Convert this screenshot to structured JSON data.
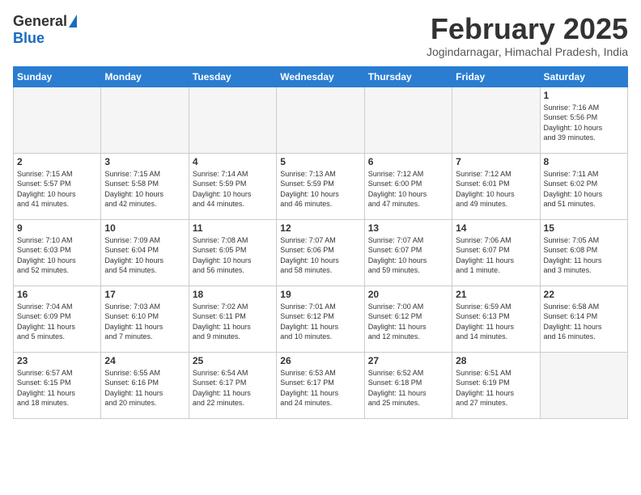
{
  "header": {
    "logo_general": "General",
    "logo_blue": "Blue",
    "month_title": "February 2025",
    "location": "Jogindarnagar, Himachal Pradesh, India"
  },
  "weekdays": [
    "Sunday",
    "Monday",
    "Tuesday",
    "Wednesday",
    "Thursday",
    "Friday",
    "Saturday"
  ],
  "weeks": [
    [
      {
        "day": "",
        "info": ""
      },
      {
        "day": "",
        "info": ""
      },
      {
        "day": "",
        "info": ""
      },
      {
        "day": "",
        "info": ""
      },
      {
        "day": "",
        "info": ""
      },
      {
        "day": "",
        "info": ""
      },
      {
        "day": "1",
        "info": "Sunrise: 7:16 AM\nSunset: 5:56 PM\nDaylight: 10 hours\nand 39 minutes."
      }
    ],
    [
      {
        "day": "2",
        "info": "Sunrise: 7:15 AM\nSunset: 5:57 PM\nDaylight: 10 hours\nand 41 minutes."
      },
      {
        "day": "3",
        "info": "Sunrise: 7:15 AM\nSunset: 5:58 PM\nDaylight: 10 hours\nand 42 minutes."
      },
      {
        "day": "4",
        "info": "Sunrise: 7:14 AM\nSunset: 5:59 PM\nDaylight: 10 hours\nand 44 minutes."
      },
      {
        "day": "5",
        "info": "Sunrise: 7:13 AM\nSunset: 5:59 PM\nDaylight: 10 hours\nand 46 minutes."
      },
      {
        "day": "6",
        "info": "Sunrise: 7:12 AM\nSunset: 6:00 PM\nDaylight: 10 hours\nand 47 minutes."
      },
      {
        "day": "7",
        "info": "Sunrise: 7:12 AM\nSunset: 6:01 PM\nDaylight: 10 hours\nand 49 minutes."
      },
      {
        "day": "8",
        "info": "Sunrise: 7:11 AM\nSunset: 6:02 PM\nDaylight: 10 hours\nand 51 minutes."
      }
    ],
    [
      {
        "day": "9",
        "info": "Sunrise: 7:10 AM\nSunset: 6:03 PM\nDaylight: 10 hours\nand 52 minutes."
      },
      {
        "day": "10",
        "info": "Sunrise: 7:09 AM\nSunset: 6:04 PM\nDaylight: 10 hours\nand 54 minutes."
      },
      {
        "day": "11",
        "info": "Sunrise: 7:08 AM\nSunset: 6:05 PM\nDaylight: 10 hours\nand 56 minutes."
      },
      {
        "day": "12",
        "info": "Sunrise: 7:07 AM\nSunset: 6:06 PM\nDaylight: 10 hours\nand 58 minutes."
      },
      {
        "day": "13",
        "info": "Sunrise: 7:07 AM\nSunset: 6:07 PM\nDaylight: 10 hours\nand 59 minutes."
      },
      {
        "day": "14",
        "info": "Sunrise: 7:06 AM\nSunset: 6:07 PM\nDaylight: 11 hours\nand 1 minute."
      },
      {
        "day": "15",
        "info": "Sunrise: 7:05 AM\nSunset: 6:08 PM\nDaylight: 11 hours\nand 3 minutes."
      }
    ],
    [
      {
        "day": "16",
        "info": "Sunrise: 7:04 AM\nSunset: 6:09 PM\nDaylight: 11 hours\nand 5 minutes."
      },
      {
        "day": "17",
        "info": "Sunrise: 7:03 AM\nSunset: 6:10 PM\nDaylight: 11 hours\nand 7 minutes."
      },
      {
        "day": "18",
        "info": "Sunrise: 7:02 AM\nSunset: 6:11 PM\nDaylight: 11 hours\nand 9 minutes."
      },
      {
        "day": "19",
        "info": "Sunrise: 7:01 AM\nSunset: 6:12 PM\nDaylight: 11 hours\nand 10 minutes."
      },
      {
        "day": "20",
        "info": "Sunrise: 7:00 AM\nSunset: 6:12 PM\nDaylight: 11 hours\nand 12 minutes."
      },
      {
        "day": "21",
        "info": "Sunrise: 6:59 AM\nSunset: 6:13 PM\nDaylight: 11 hours\nand 14 minutes."
      },
      {
        "day": "22",
        "info": "Sunrise: 6:58 AM\nSunset: 6:14 PM\nDaylight: 11 hours\nand 16 minutes."
      }
    ],
    [
      {
        "day": "23",
        "info": "Sunrise: 6:57 AM\nSunset: 6:15 PM\nDaylight: 11 hours\nand 18 minutes."
      },
      {
        "day": "24",
        "info": "Sunrise: 6:55 AM\nSunset: 6:16 PM\nDaylight: 11 hours\nand 20 minutes."
      },
      {
        "day": "25",
        "info": "Sunrise: 6:54 AM\nSunset: 6:17 PM\nDaylight: 11 hours\nand 22 minutes."
      },
      {
        "day": "26",
        "info": "Sunrise: 6:53 AM\nSunset: 6:17 PM\nDaylight: 11 hours\nand 24 minutes."
      },
      {
        "day": "27",
        "info": "Sunrise: 6:52 AM\nSunset: 6:18 PM\nDaylight: 11 hours\nand 25 minutes."
      },
      {
        "day": "28",
        "info": "Sunrise: 6:51 AM\nSunset: 6:19 PM\nDaylight: 11 hours\nand 27 minutes."
      },
      {
        "day": "",
        "info": ""
      }
    ]
  ]
}
